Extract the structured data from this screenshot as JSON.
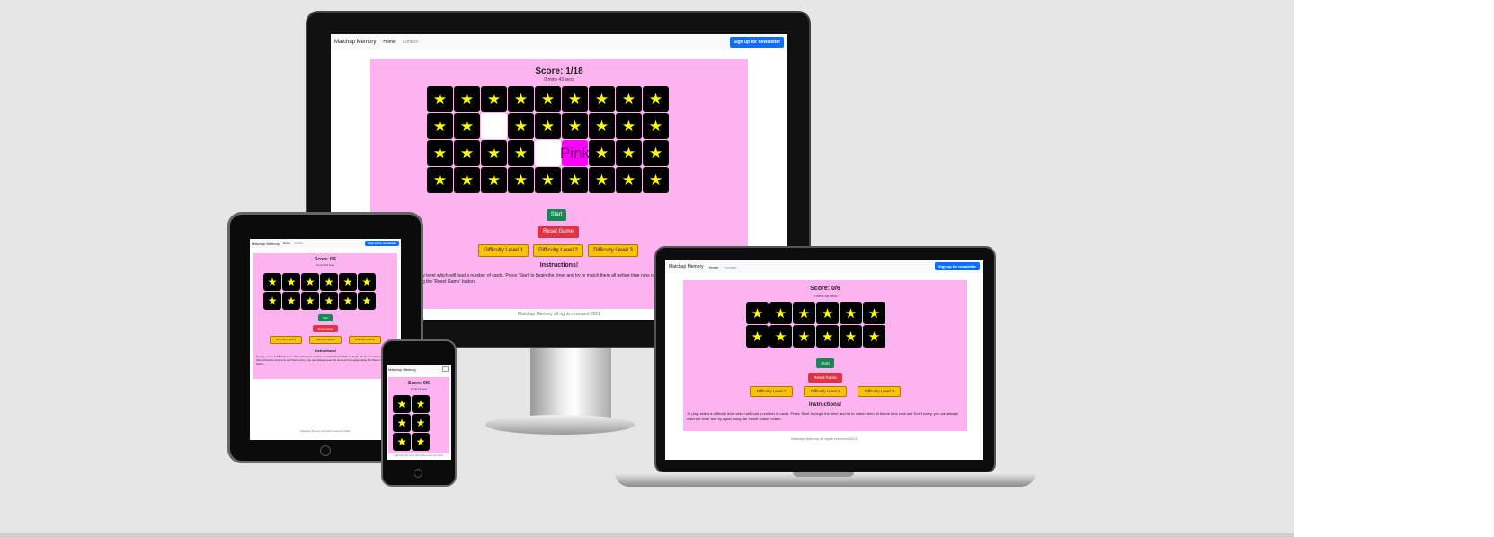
{
  "app": {
    "brand": "Matchup Memory",
    "nav_home": "Home",
    "nav_contact": "Contact",
    "signup": "Sign up for newsletter",
    "start": "Start",
    "reset": "Reset Game",
    "levels": [
      "Difficulty Level 1",
      "Difficulty Level 2",
      "Difficulty Level 3"
    ],
    "instructions_title": "Instructions!",
    "instructions_text": "To play, select a difficulty level which will load a number of cards. Press 'Start' to begin the timer and try to match them all before time runs out! Don't worry, you can always reset the timer and try again using the 'Reset Game' button.",
    "footer": "Matchup Memory all rights reserved 2021",
    "card_symbol": "★",
    "pink_label": "Pink"
  },
  "desktop": {
    "score": "Score: 1/18",
    "timer": "0 mins 43 secs"
  },
  "tablet": {
    "score": "Score: 0/6",
    "timer": "0 mins 34 secs"
  },
  "phone": {
    "score": "Score: 0/6",
    "timer": "0 mins 0 secs"
  },
  "laptop": {
    "score": "Score: 0/6",
    "timer": "0 mins 48 secs"
  },
  "colors": {
    "backdrop": "#e6e6e6",
    "game_bg": "#fcb3f0",
    "card": "#000000",
    "star": "#ffff00",
    "pink_card": "#ff00ff",
    "start_btn": "#198754",
    "reset_btn": "#dc3545",
    "level_btn": "#ffc107",
    "signup_btn": "#0d6efd"
  }
}
